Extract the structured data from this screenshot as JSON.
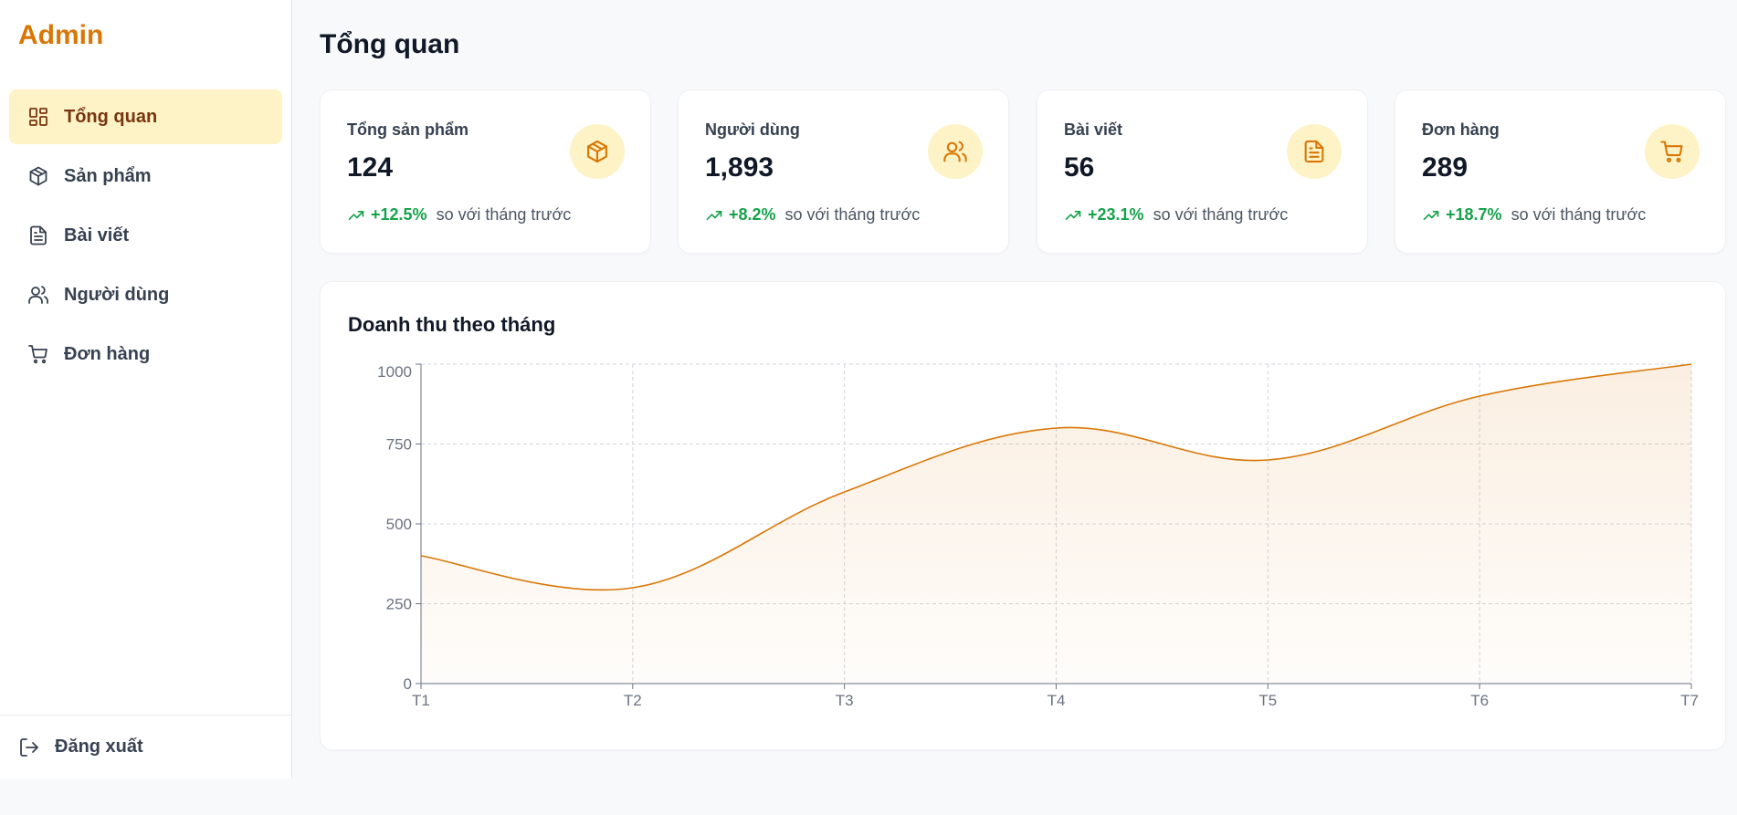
{
  "brand": "Admin",
  "nav": [
    {
      "label": "Tổng quan",
      "icon": "dashboard-icon",
      "active": true
    },
    {
      "label": "Sản phẩm",
      "icon": "package-icon",
      "active": false
    },
    {
      "label": "Bài viết",
      "icon": "document-icon",
      "active": false
    },
    {
      "label": "Người dùng",
      "icon": "users-icon",
      "active": false
    },
    {
      "label": "Đơn hàng",
      "icon": "cart-icon",
      "active": false
    }
  ],
  "logout": {
    "label": "Đăng xuất",
    "icon": "logout-icon"
  },
  "page_title": "Tổng quan",
  "stats": [
    {
      "title": "Tổng sản phẩm",
      "value": "124",
      "change": "+12.5%",
      "note": "so với tháng trước",
      "icon": "package-icon"
    },
    {
      "title": "Người dùng",
      "value": "1,893",
      "change": "+8.2%",
      "note": "so với tháng trước",
      "icon": "users-icon"
    },
    {
      "title": "Bài viết",
      "value": "56",
      "change": "+23.1%",
      "note": "so với tháng trước",
      "icon": "document-icon"
    },
    {
      "title": "Đơn hàng",
      "value": "289",
      "change": "+18.7%",
      "note": "so với tháng trước",
      "icon": "cart-icon"
    }
  ],
  "colors": {
    "accent": "#d97706",
    "accent_light": "#fef3c7",
    "positive": "#16a34a"
  },
  "chart_data": {
    "type": "area",
    "title": "Doanh thu theo tháng",
    "categories": [
      "T1",
      "T2",
      "T3",
      "T4",
      "T5",
      "T6",
      "T7"
    ],
    "values": [
      400,
      300,
      600,
      800,
      700,
      900,
      1000
    ],
    "ylim": [
      0,
      1000
    ],
    "yticks": [
      0,
      250,
      500,
      750,
      1000
    ],
    "grid": true,
    "color": "#d97706"
  }
}
